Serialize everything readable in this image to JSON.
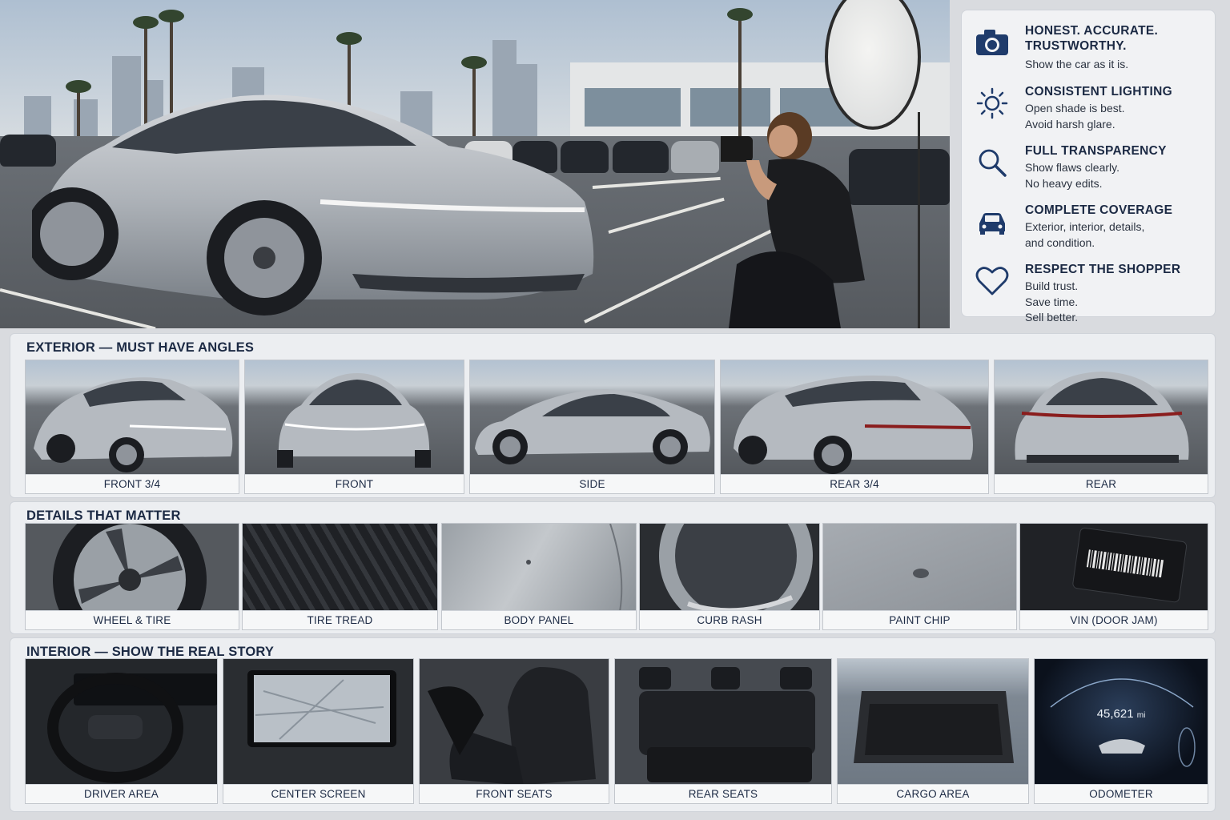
{
  "principles": [
    {
      "title": "HONEST. ACCURATE. TRUSTWORTHY.",
      "desc": "Show the car as it is.",
      "icon": "camera-icon"
    },
    {
      "title": "CONSISTENT LIGHTING",
      "desc": "Open shade is best. Avoid harsh glare.",
      "icon": "sun-icon"
    },
    {
      "title": "FULL TRANSPARENCY",
      "desc": "Show flaws clearly. No heavy edits.",
      "icon": "magnifier-icon"
    },
    {
      "title": "COMPLETE COVERAGE",
      "desc": "Exterior, interior, details, and condition.",
      "icon": "car-icon"
    },
    {
      "title": "RESPECT THE SHOPPER",
      "desc": "Build trust. Save time. Sell better.",
      "icon": "heart-icon"
    }
  ],
  "exterior": {
    "title": "EXTERIOR — MUST HAVE ANGLES",
    "tiles": [
      "FRONT 3/4",
      "FRONT",
      "SIDE",
      "REAR 3/4",
      "REAR"
    ]
  },
  "details": {
    "title": "DETAILS THAT MATTER",
    "tiles": [
      "WHEEL & TIRE",
      "TIRE TREAD",
      "BODY PANEL",
      "CURB RASH",
      "PAINT CHIP",
      "VIN (DOOR JAM)"
    ]
  },
  "interior": {
    "title": "INTERIOR — SHOW THE REAL STORY",
    "tiles": [
      "DRIVER AREA",
      "CENTER SCREEN",
      "FRONT SEATS",
      "REAR SEATS",
      "CARGO AREA",
      "ODOMETER"
    ]
  },
  "odometer_reading": "45,621",
  "odometer_unit": "mi",
  "colors": {
    "navy": "#1c2a44",
    "panel": "#f1f2f4",
    "car_silver": "#b8bcc2"
  }
}
